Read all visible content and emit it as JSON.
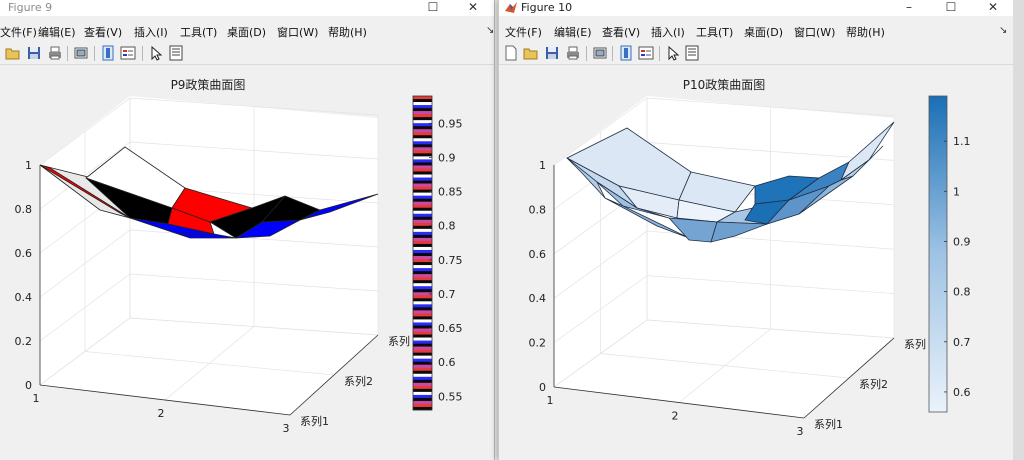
{
  "windows": [
    {
      "title": "Figure 9",
      "menu": [
        "文件(F)",
        "编辑(E)",
        "查看(V)",
        "插入(I)",
        "工具(T)",
        "桌面(D)",
        "窗口(W)",
        "帮助(H)"
      ],
      "controls": {
        "minimize": "–",
        "maximize": "☐",
        "close": "✕"
      },
      "toolbar_icons": [
        "new-figure-icon",
        "open-file-icon",
        "save-icon",
        "print-icon",
        "link-plot-icon",
        "insert-colorbar-icon",
        "insert-legend-icon",
        "edit-plot-icon",
        "property-inspector-icon"
      ],
      "chart_data": {
        "type": "surface",
        "title": "P9政策曲面图",
        "x_ticks": [
          "1",
          "2",
          "3"
        ],
        "y_ticks": [
          "系列1",
          "系列2",
          "系列"
        ],
        "z_ticks": [
          "0",
          "0.2",
          "0.4",
          "0.6",
          "0.8",
          "1"
        ],
        "zlim": [
          0,
          1
        ],
        "grid": true,
        "colormap": "striped red / black / white / blue",
        "colorbar": {
          "ticks": [
            "0.95",
            "0.9",
            "0.85",
            "0.8",
            "0.75",
            "0.7",
            "0.65",
            "0.6",
            "0.55"
          ],
          "range": [
            0.53,
            0.99
          ],
          "placement": "right"
        },
        "surface_z": [
          [
            1.0,
            0.9,
            0.8,
            0.72,
            0.68,
            0.7,
            0.74,
            0.82
          ],
          [
            0.98,
            0.88,
            0.78,
            0.7,
            0.65,
            0.68,
            0.72,
            0.8
          ]
        ]
      }
    },
    {
      "title": "Figure 10",
      "menu": [
        "文件(F)",
        "编辑(E)",
        "查看(V)",
        "插入(I)",
        "工具(T)",
        "桌面(D)",
        "窗口(W)",
        "帮助(H)"
      ],
      "controls": {
        "minimize": "–",
        "maximize": "☐",
        "close": "✕"
      },
      "toolbar_icons": [
        "new-figure-icon",
        "open-file-icon",
        "save-icon",
        "print-icon",
        "link-plot-icon",
        "insert-colorbar-icon",
        "insert-legend-icon",
        "edit-plot-icon",
        "property-inspector-icon"
      ],
      "chart_data": {
        "type": "surface",
        "title": "P10政策曲面图",
        "x_ticks": [
          "1",
          "2",
          "3"
        ],
        "y_ticks": [
          "系列1",
          "系列2",
          "系列"
        ],
        "z_ticks": [
          "0",
          "0.2",
          "0.4",
          "0.6",
          "0.8",
          "1"
        ],
        "zlim": [
          0,
          1
        ],
        "grid": true,
        "colormap": "light blue to dark blue",
        "colorbar": {
          "ticks": [
            "1.1",
            "1",
            "0.9",
            "0.8",
            "0.7",
            "0.6"
          ],
          "range": [
            0.56,
            1.19
          ],
          "placement": "right"
        },
        "surface_z": [
          [
            1.0,
            0.85,
            0.72,
            0.62,
            0.58,
            0.64,
            0.74,
            0.9,
            1.15
          ],
          [
            0.98,
            0.92,
            0.8,
            0.68,
            0.63,
            0.7,
            0.82,
            1.0,
            1.19
          ]
        ]
      }
    }
  ]
}
